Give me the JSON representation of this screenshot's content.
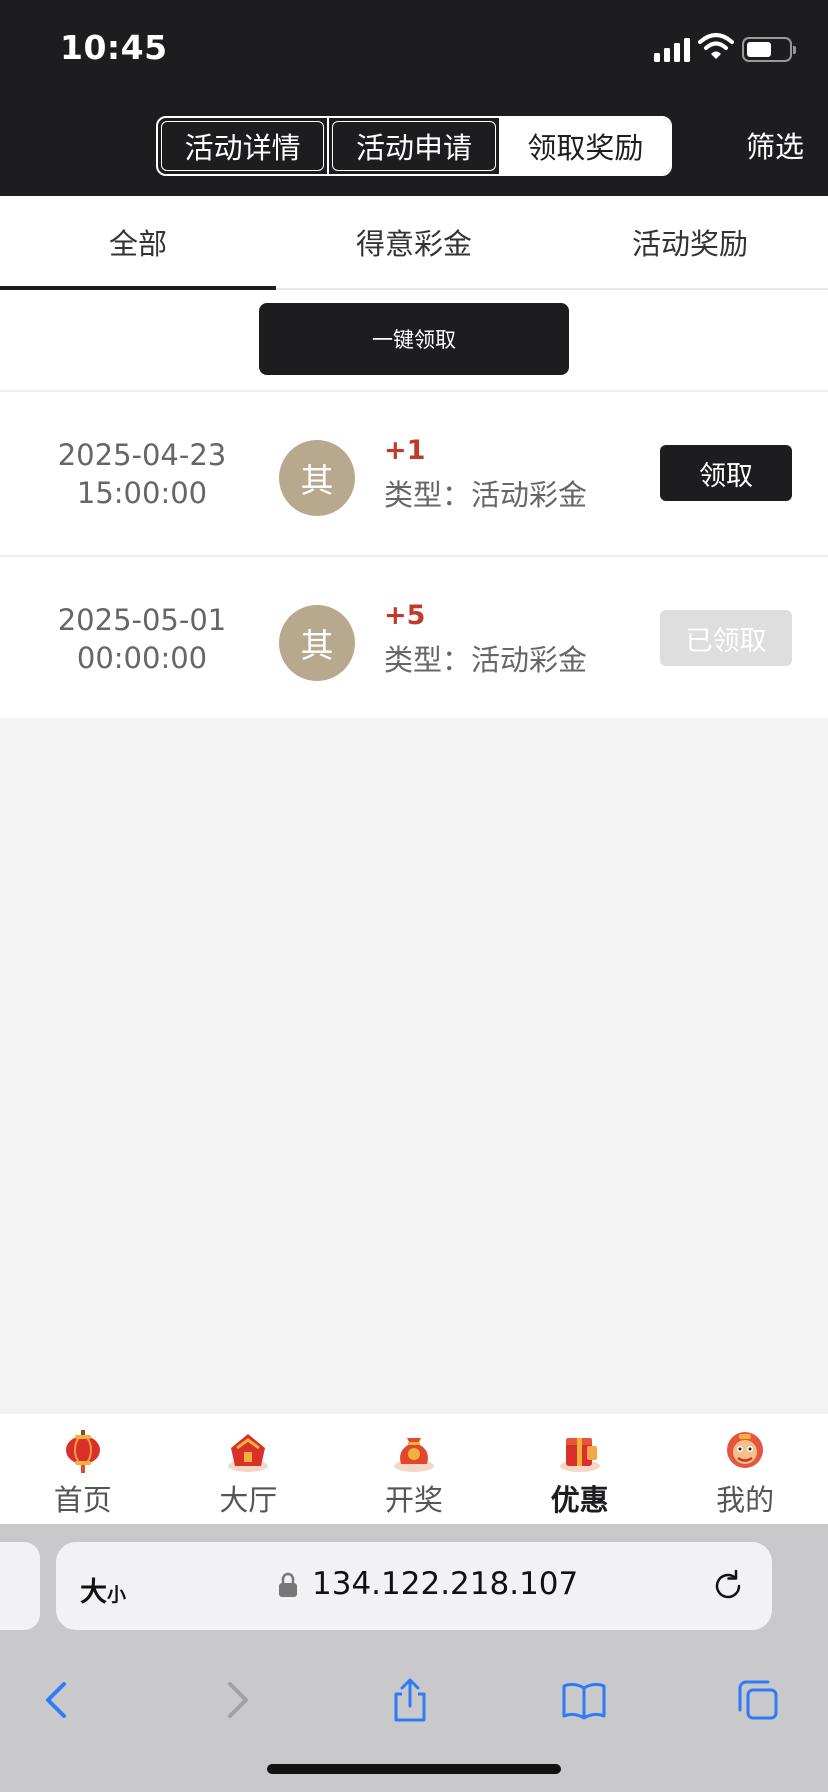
{
  "status_bar": {
    "time": "10:45"
  },
  "header": {
    "segments": [
      {
        "label": "活动详情",
        "active": false
      },
      {
        "label": "活动申请",
        "active": false
      },
      {
        "label": "领取奖励",
        "active": true
      }
    ],
    "filter_label": "筛选"
  },
  "tabs": [
    {
      "label": "全部",
      "active": true
    },
    {
      "label": "得意彩金",
      "active": false
    },
    {
      "label": "活动奖励",
      "active": false
    }
  ],
  "claim_all_label": "一键领取",
  "rewards": [
    {
      "date": "2025-04-23",
      "time": "15:00:00",
      "avatar_text": "其",
      "amount": "+1",
      "type": "类型：活动彩金",
      "button": "领取",
      "claimed": false
    },
    {
      "date": "2025-05-01",
      "time": "00:00:00",
      "avatar_text": "其",
      "amount": "+5",
      "type": "类型：活动彩金",
      "button": "已领取",
      "claimed": true
    }
  ],
  "bottom_nav": [
    {
      "label": "首页",
      "icon": "lantern-icon",
      "active": false
    },
    {
      "label": "大厅",
      "icon": "hall-icon",
      "active": false
    },
    {
      "label": "开奖",
      "icon": "lucky-bag-icon",
      "active": false
    },
    {
      "label": "优惠",
      "icon": "gift-box-icon",
      "active": true
    },
    {
      "label": "我的",
      "icon": "lion-face-icon",
      "active": false
    }
  ],
  "browser": {
    "aa_big": "大",
    "aa_small": "小",
    "url": "134.122.218.107"
  },
  "colors": {
    "header_bg": "#1d1d1f",
    "amount_red": "#c0392b",
    "avatar_tan": "#b8a88d",
    "safari_blue": "#2f7bf5"
  }
}
